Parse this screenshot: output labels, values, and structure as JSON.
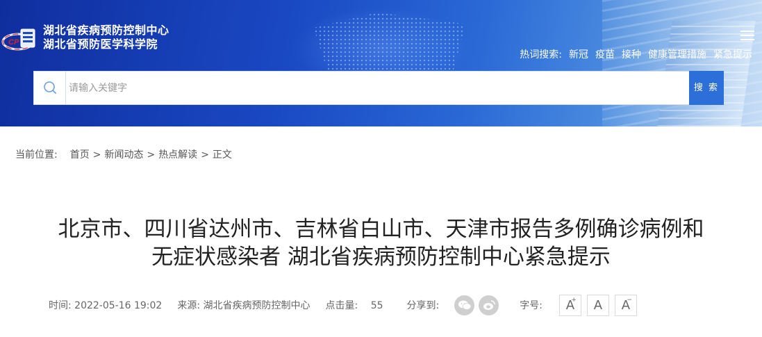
{
  "header": {
    "org_name_line1": "湖北省疾病预防控制中心",
    "org_name_line2": "湖北省预防医学科学院",
    "logo_text": "HBCDC",
    "hot_label": "热词搜索:",
    "hot_words": [
      "新冠",
      "疫苗",
      "接种",
      "健康管理措施",
      "紧急提示"
    ],
    "search_placeholder": "请输入关键字",
    "search_button": "搜 索"
  },
  "breadcrumb": {
    "label": "当前位置:",
    "items": [
      "首页",
      "新闻动态",
      "热点解读",
      "正文"
    ],
    "separator": ">"
  },
  "article": {
    "title_line1": "北京市、四川省达州市、吉林省白山市、天津市报告多例确诊病例和",
    "title_line2": "无症状感染者 湖北省疾病预防控制中心紧急提示",
    "time_label": "时间:",
    "time_value": "2022-05-16 19:02",
    "source_label": "来源:",
    "source_value": "湖北省疾病预防控制中心",
    "clicks_label": "点击量:",
    "clicks_value": "55",
    "share_label": "分享到:",
    "share_targets": [
      "wechat-icon",
      "weibo-icon"
    ],
    "font_label": "字号:",
    "font_buttons": {
      "increase": "A",
      "increase_mark": "+",
      "normal": "A",
      "decrease": "A",
      "decrease_mark": "−"
    }
  },
  "colors": {
    "banner_dark": "#0f2e9e",
    "banner_light": "#9fc4ee",
    "search_button": "#2d6fd9",
    "share_icon_bg": "#cfcfcf"
  }
}
